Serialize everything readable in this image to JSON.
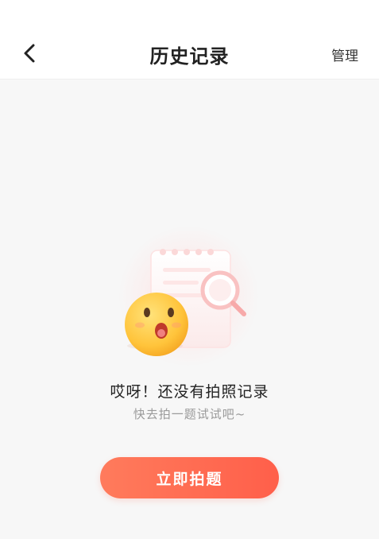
{
  "header": {
    "title": "历史记录",
    "manage_label": "管理",
    "back_icon": "chevron-left-icon"
  },
  "empty_state": {
    "illustration": "surprised-emoji-with-notepad-and-magnifier",
    "title": "哎呀！还没有拍照记录",
    "subtitle": "快去拍一题试试吧~"
  },
  "cta": {
    "label": "立即拍题",
    "color_start": "#ff7b5c",
    "color_end": "#ff5f4a"
  },
  "colors": {
    "background": "#f7f7f7",
    "header_bg": "#ffffff",
    "accent": "#ff6a52"
  }
}
